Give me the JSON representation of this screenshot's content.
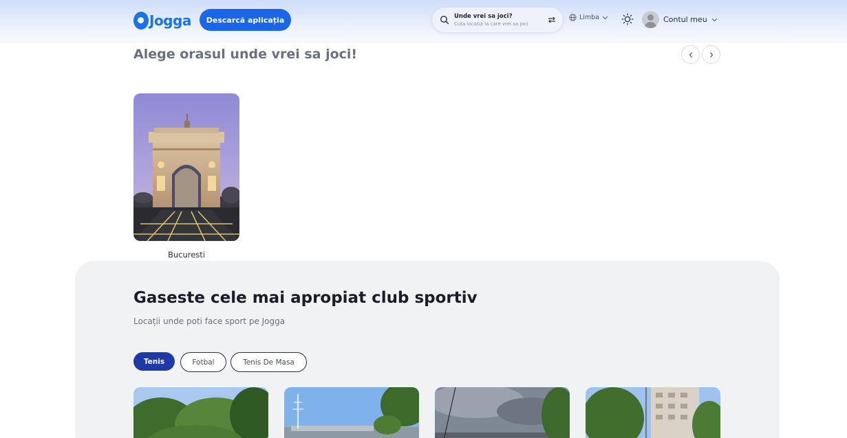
{
  "header": {
    "logo_text": "Jogga",
    "download_label": "Descarcă aplicația",
    "search_title": "Unde vrei sa joci?",
    "search_subtitle": "Cuta locatia la care vrei sa joci",
    "language_label": "Limba",
    "account_label": "Contul meu"
  },
  "cities": {
    "title": "Alege orasul unde vrei sa joci!",
    "items": [
      {
        "label": "Bucuresti"
      }
    ]
  },
  "clubs": {
    "title": "Gaseste cele mai apropiat club sportiv",
    "subtitle": "Locații unde poti face sport pe Jogga",
    "tabs": [
      {
        "label": "Tenis",
        "active": true
      },
      {
        "label": "Fotbal",
        "active": false
      },
      {
        "label": "Tenis De Masa",
        "active": false
      }
    ]
  },
  "colors": {
    "brand_blue": "#1a66e8",
    "active_tab": "#1e3aa8",
    "section_bg": "#f1f2f4"
  },
  "icons": [
    "search-icon",
    "filter-icon",
    "globe-icon",
    "chevron-down-icon",
    "sun-icon",
    "avatar",
    "chevron-left-icon",
    "chevron-right-icon"
  ]
}
